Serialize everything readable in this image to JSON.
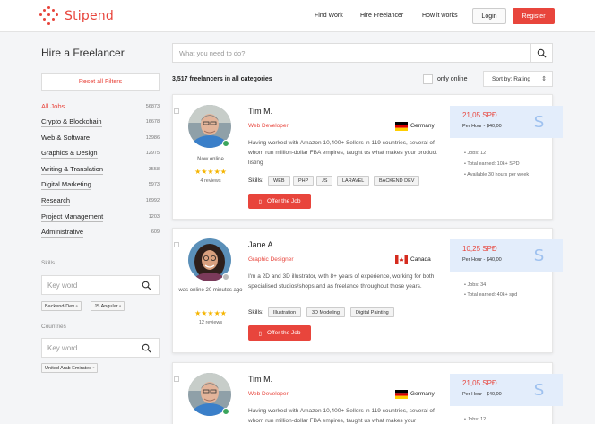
{
  "header": {
    "brand": "Stipend",
    "nav": [
      "Find Work",
      "Hire Freelancer",
      "How it works"
    ],
    "login": "Login",
    "register": "Register"
  },
  "sidebar": {
    "title": "Hire a Freelancer",
    "reset": "Reset all Filters",
    "categories": [
      {
        "label": "All Jobs",
        "count": "56873"
      },
      {
        "label": "Crypto & Blockchain",
        "count": "16678"
      },
      {
        "label": "Web & Software",
        "count": "13986"
      },
      {
        "label": "Graphics & Design",
        "count": "12975"
      },
      {
        "label": "Writing & Translation",
        "count": "3558"
      },
      {
        "label": "Digital Marketing",
        "count": "5973"
      },
      {
        "label": "Research",
        "count": "16992"
      },
      {
        "label": "Project Management",
        "count": "1203"
      },
      {
        "label": "Administrative",
        "count": "609"
      }
    ],
    "skills_title": "Skills",
    "skills_placeholder": "Key word",
    "skill_tags": [
      "Backend-Dev",
      "JS Angular"
    ],
    "countries_title": "Countries",
    "countries_placeholder": "Key word",
    "country_tags": [
      "United Arab Emirates"
    ]
  },
  "main": {
    "search_placeholder": "What you need to do?",
    "result_count": "3,517 freelancers in all categories",
    "only_online": "only online",
    "sort": "Sort by: Rating"
  },
  "cards": [
    {
      "name": "Tim M.",
      "role": "Web Developer",
      "country": "Germany",
      "status": "Now online",
      "stars": "★★★★★",
      "reviews": "4 reviews",
      "desc": "Having worked with Amazon 10,400+ Sellers in 119 countries, several of whom run million-dollar FBA empires, taught us what makes your product listing",
      "skills_label": "Skills:",
      "skills": [
        "WEB",
        "PHP",
        "JS",
        "LARAVEL",
        "BACKEND DEV"
      ],
      "offer": "Offer the Job",
      "price": "21,05 SPĐ",
      "per_hour": "Per Hour - $40,00",
      "stats": [
        "• Jobs: 12",
        "• Total earned: 10k+ SPD",
        "• Available 30 hours per week"
      ]
    },
    {
      "name": "Jane A.",
      "role": "Graphic Designer",
      "country": "Canada",
      "status": "was online 20 minutes ago",
      "stars": "★★★★★",
      "reviews": "12 reviews",
      "desc": "I'm a 2D and 3D illustrator, with 8+ years of experience, working for both specialised studios/shops and as freelance throughout those years.",
      "skills_label": "Skills:",
      "skills": [
        "Illustration",
        "3D Modeling",
        "Digital Painting"
      ],
      "offer": "Offer the Job",
      "price": "10,25 SPĐ",
      "per_hour": "Per Hour - $40,00",
      "stats": [
        "• Jobs: 34",
        "• Total earned: 40k+ spd"
      ]
    },
    {
      "name": "Tim M.",
      "role": "Web Developer",
      "country": "Germany",
      "desc": "Having worked with Amazon 10,400+ Sellers in 119 countries, several of whom run million-dollar FBA empires, taught us what makes your",
      "price": "21,05 SPĐ",
      "per_hour": "Per Hour - $40,00",
      "stats": [
        "• Jobs: 12"
      ]
    }
  ],
  "colors": {
    "accent": "#e8453c",
    "online": "#3ba55c",
    "price_bg": "#e3edfb",
    "star": "#f5b400"
  }
}
